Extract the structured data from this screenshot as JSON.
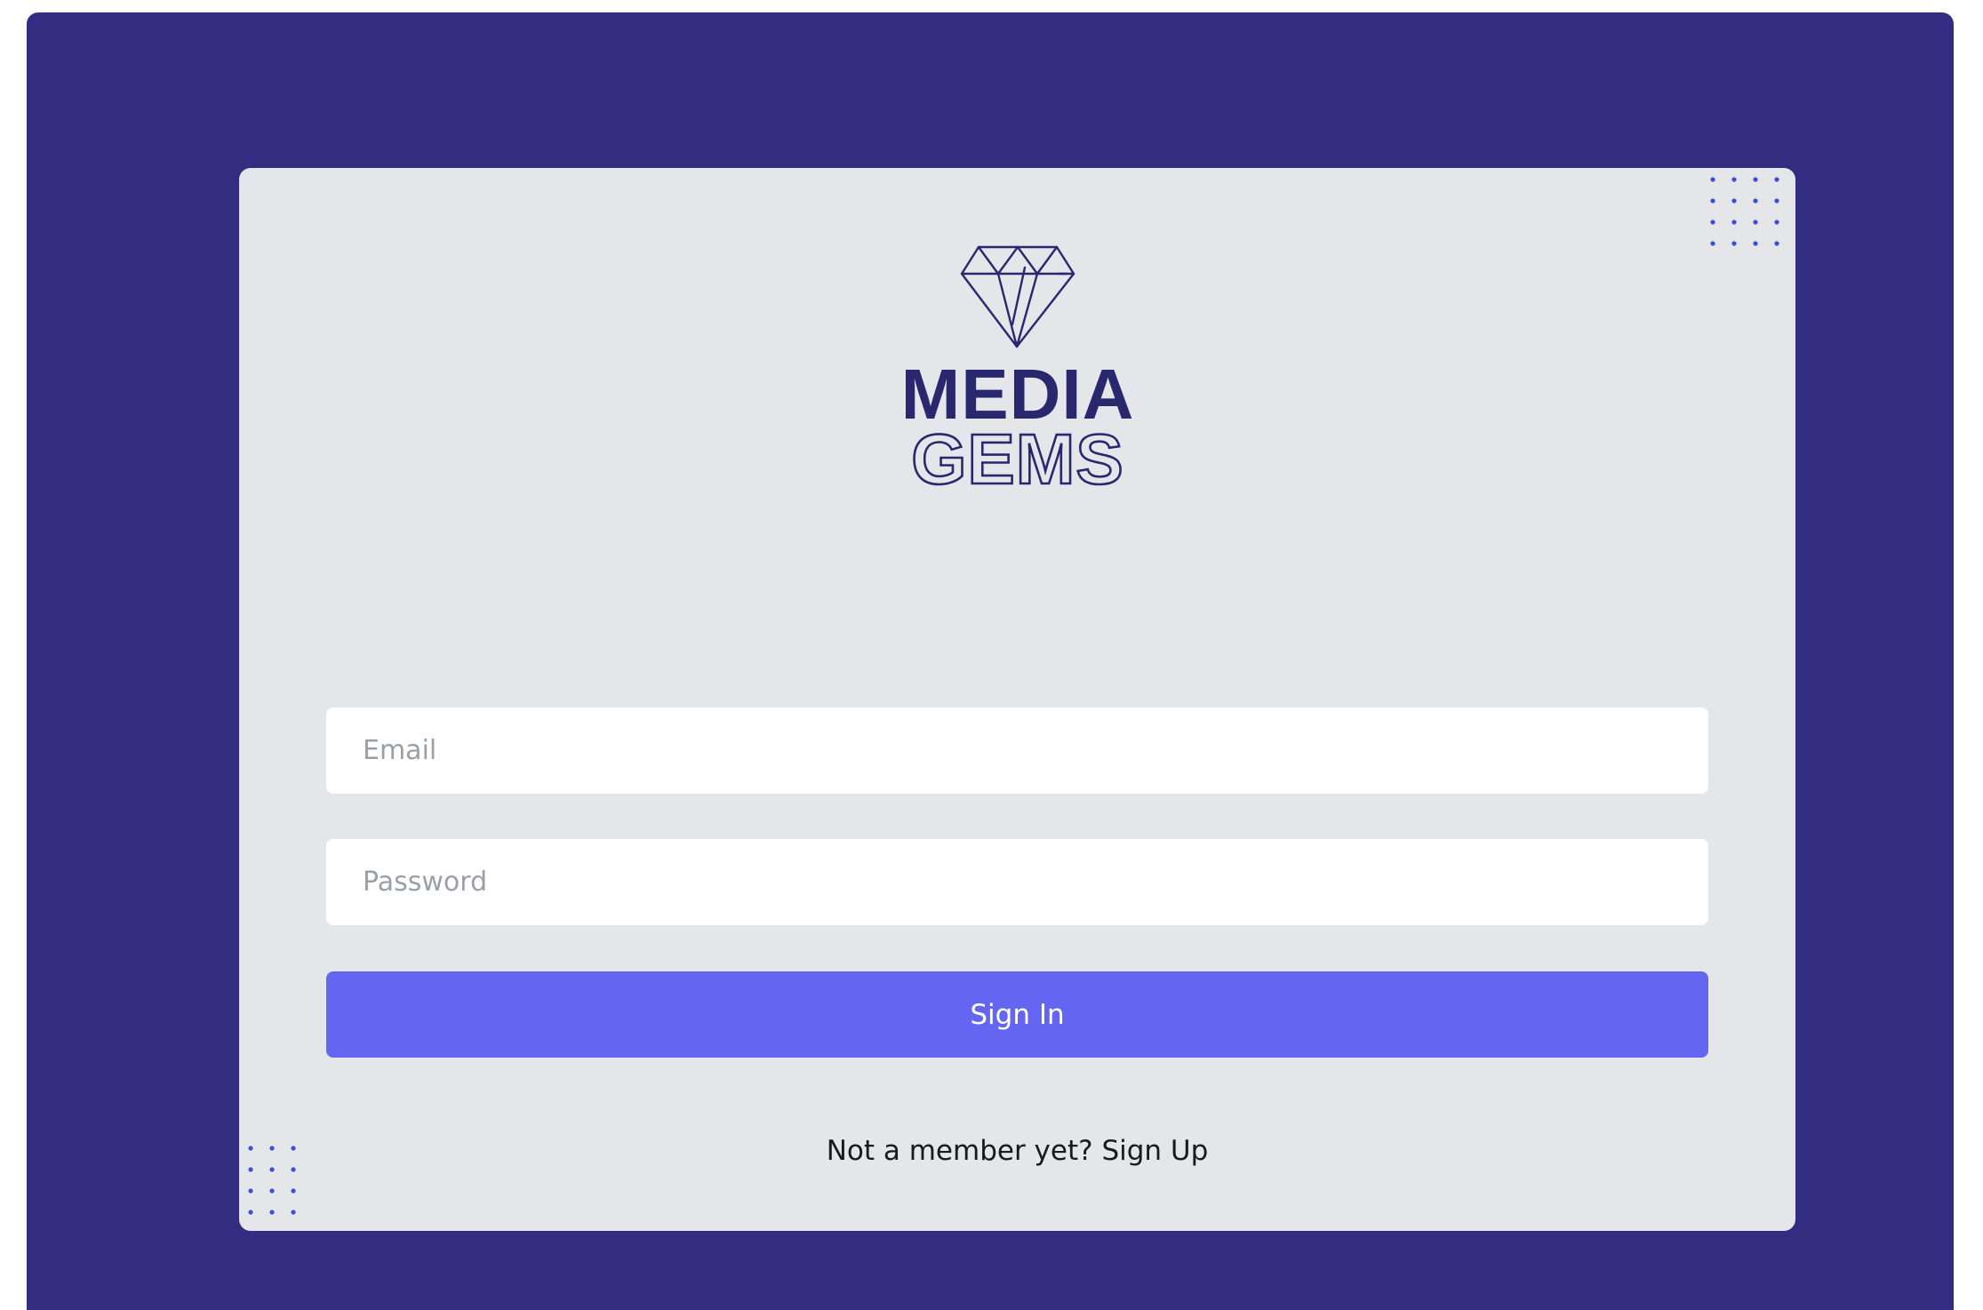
{
  "brand": {
    "line1": "MEDIA",
    "line2": "GEMS",
    "color": "#29286f"
  },
  "form": {
    "email_placeholder": "Email",
    "password_placeholder": "Password",
    "submit_label": "Sign In"
  },
  "footer": {
    "prompt": "Not a member yet?",
    "link_label": "Sign Up"
  },
  "colors": {
    "page_background": "#322d81",
    "card_background": "#e5e6ea",
    "button": "#6466f1",
    "dot_accent": "#3b4fd8"
  },
  "icons": [
    "diamond-icon",
    "dot-grid-decoration"
  ]
}
